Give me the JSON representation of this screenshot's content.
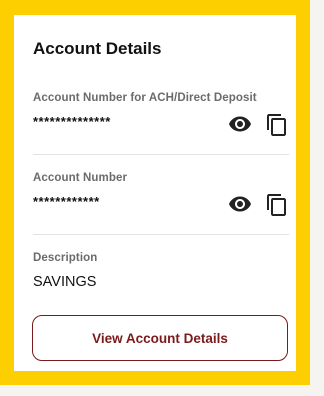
{
  "card": {
    "title": "Account Details"
  },
  "ach_account": {
    "label": "Account Number for ACH/Direct Deposit",
    "value": "**************"
  },
  "account": {
    "label": "Account Number",
    "value": "************"
  },
  "description": {
    "label": "Description",
    "value": "SAVINGS"
  },
  "actions": {
    "view_details_label": "View Account Details"
  },
  "colors": {
    "frame": "#fdcf00",
    "button_accent": "#7b1a1a"
  },
  "icons": {
    "reveal": "eye-icon",
    "copy": "copy-icon"
  }
}
